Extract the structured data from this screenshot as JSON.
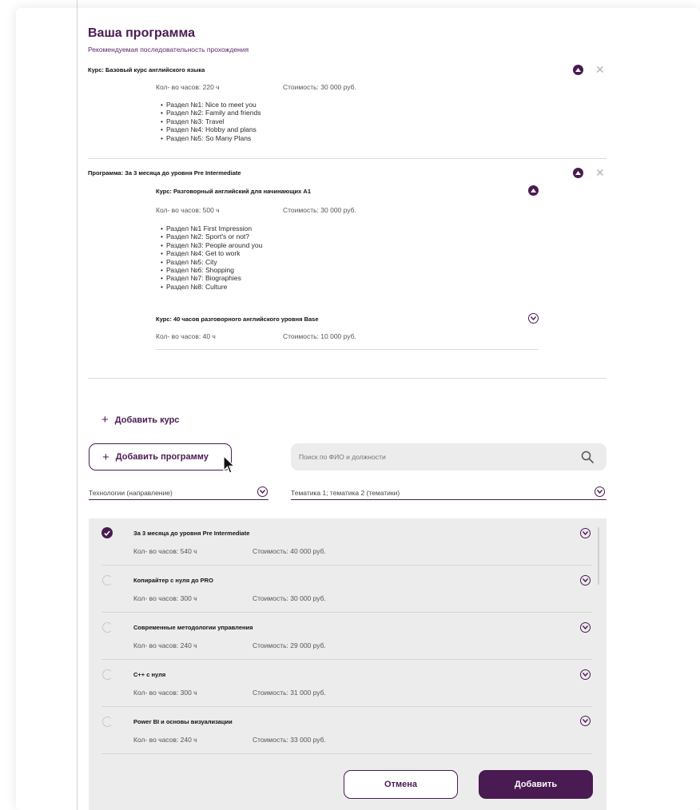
{
  "header": {
    "title": "Ваша программа",
    "subtitle": "Рекомендуемая последовательность прохождения"
  },
  "program_items": [
    {
      "title": "Курс: Базовый курс английского языка",
      "hours": "Кол- во часов: 220 ч",
      "cost": "Стоимость: 30 000 руб.",
      "sections": [
        "Раздел №1: Nice to meet you",
        "Раздел №2: Family and friends",
        "Раздел №3: Travel",
        "Раздел №4: Hobby and plans",
        "Раздел №5: So Many Plans"
      ]
    },
    {
      "title": "Программа: За 3 месяца до уровня Pre Intermediate",
      "courses": [
        {
          "title": "Курс: Разговорный английский для начинающих А1",
          "hours": "Кол- во часов: 500 ч",
          "cost": "Стоимость: 30 000 руб.",
          "sections": [
            "Раздел №1 First Impression",
            "Раздел №2: Sport's or not?",
            "Раздел №3: People around you",
            "Раздел №4: Get to work",
            "Раздел №5: City",
            "Раздел №6: Shopping",
            "Раздел №7: Biographies",
            "Раздел №8: Culture"
          ]
        },
        {
          "title": "Курс: 40 часов разговорного английского уровня Base",
          "hours": "Кол- во часов: 40 ч",
          "cost": "Стоимость: 10 000 руб."
        }
      ]
    }
  ],
  "actions": {
    "add_course": "Добавить курс",
    "add_program": "Добавить программу",
    "plus": "+"
  },
  "search": {
    "placeholder": "Поиск по ФИО и должности"
  },
  "filters": {
    "direction": "Технологии (направление)",
    "topics": "Тематика 1; тематика 2 (тематики)"
  },
  "catalog": [
    {
      "title": "За 3 месяца до уровня Pre Intermediate",
      "hours": "Кол- во часов: 540 ч",
      "cost": "Стоимость: 40 000 руб.",
      "selected": true
    },
    {
      "title": "Копирайтер с нуля до PRO",
      "hours": "Кол- во часов: 300 ч",
      "cost": "Стоимость: 30 000 руб.",
      "selected": false
    },
    {
      "title": "Современные методологии управления",
      "hours": "Кол- во часов: 240 ч",
      "cost": "Стоимость: 29 000 руб.",
      "selected": false
    },
    {
      "title": "C++ с нуля",
      "hours": "Кол- во часов: 300 ч",
      "cost": "Стоимость: 31 000 руб.",
      "selected": false
    },
    {
      "title": "Power BI и основы визуализации",
      "hours": "Кол- во часов: 240 ч",
      "cost": "Стоимость: 33 000 руб.",
      "selected": false
    }
  ],
  "footer": {
    "cancel": "Отмена",
    "add": "Добавить"
  },
  "colors": {
    "accent": "#4a1a52",
    "panel": "#ececec",
    "divider": "#dcdcdc"
  }
}
